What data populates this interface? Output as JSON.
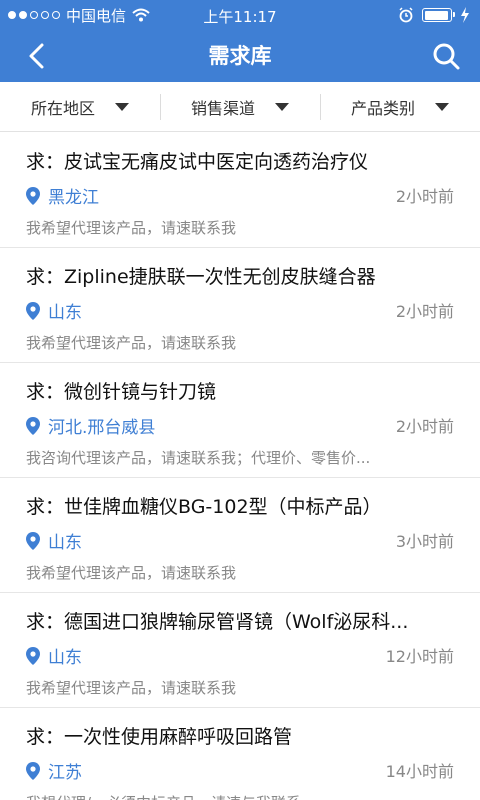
{
  "status": {
    "carrier": "中国电信",
    "time": "上午11:17"
  },
  "nav": {
    "title": "需求库"
  },
  "filters": [
    "所在地区",
    "销售渠道",
    "产品类别"
  ],
  "items": [
    {
      "title": "求：皮试宝无痛皮试中医定向透药治疗仪",
      "location": "黑龙江",
      "time": "2小时前",
      "desc": "我希望代理该产品，请速联系我"
    },
    {
      "title": "求：Zipline捷肤联一次性无创皮肤缝合器",
      "location": "山东",
      "time": "2小时前",
      "desc": "我希望代理该产品，请速联系我"
    },
    {
      "title": "求：微创针镜与针刀镜",
      "location": "河北.邢台威县",
      "time": "2小时前",
      "desc": "我咨询代理该产品，请速联系我；代理价、零售价..."
    },
    {
      "title": "求：世佳牌血糖仪BG-102型（中标产品）",
      "location": "山东",
      "time": "3小时前",
      "desc": "我希望代理该产品，请速联系我"
    },
    {
      "title": "求：德国进口狼牌输尿管肾镜（Wolf泌尿科...",
      "location": "山东",
      "time": "12小时前",
      "desc": "我希望代理该产品，请速联系我"
    },
    {
      "title": "求：一次性使用麻醉呼吸回路管",
      "location": "江苏",
      "time": "14小时前",
      "desc": "我想代理/，必须中标产品，请速与我联系"
    }
  ],
  "icons": {
    "back": "chevron-left-icon",
    "search": "search-icon",
    "location": "map-pin-icon",
    "dropdown": "triangle-down-icon"
  },
  "colors": {
    "primary": "#3f7fd4",
    "muted": "#888888"
  }
}
